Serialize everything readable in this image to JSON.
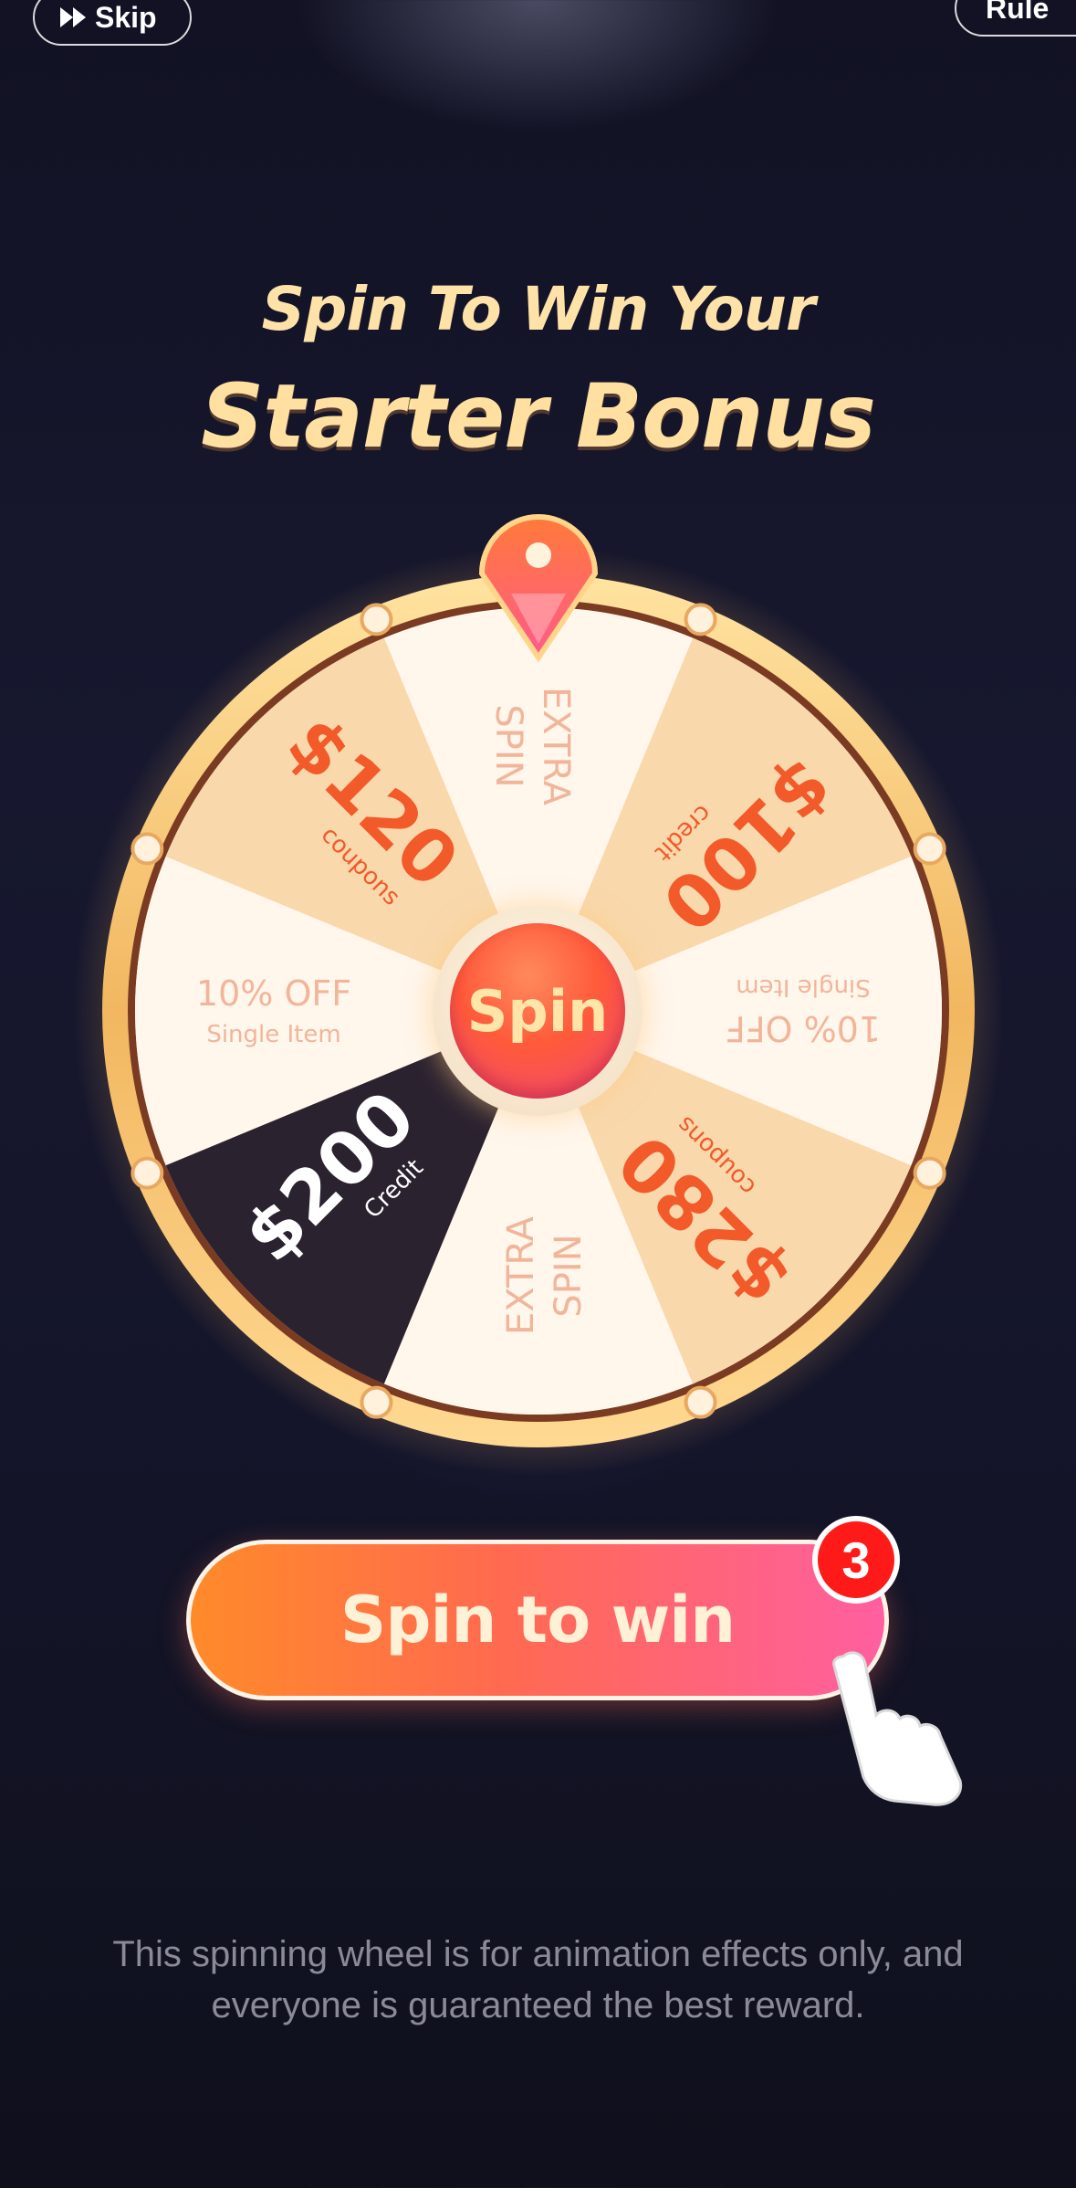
{
  "header": {
    "skip_label": "Skip",
    "rule_label": "Rule"
  },
  "title": {
    "line1": "Spin To Win Your",
    "line2": "Starter Bonus"
  },
  "wheel": {
    "center_label": "Spin",
    "segments": [
      {
        "main": "EXTRA",
        "sub": "SPIN"
      },
      {
        "main": "$100",
        "sub": "credit"
      },
      {
        "main": "10% OFF",
        "sub": "Single Item"
      },
      {
        "main": "$280",
        "sub": "coupons"
      },
      {
        "main": "EXTRA",
        "sub": "SPIN"
      },
      {
        "main": "$200",
        "sub": "Credit"
      },
      {
        "main": "10% OFF",
        "sub": "Single Item"
      },
      {
        "main": "$120",
        "sub": "coupons"
      }
    ],
    "colors": {
      "light": "#fff6ec",
      "peach": "#f9d8ac",
      "dark": "#2b2230",
      "accent": "#f25a2a",
      "muted_text": "#f1b59a",
      "rim": "#f6c777"
    }
  },
  "cta": {
    "label": "Spin to win",
    "badge": "3"
  },
  "footer": {
    "disclaimer": "This spinning wheel is for animation effects only, and everyone is guaranteed the best reward."
  }
}
